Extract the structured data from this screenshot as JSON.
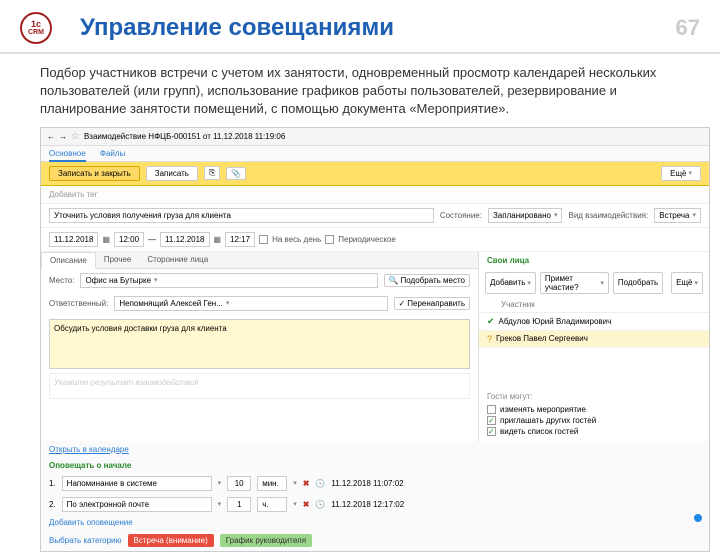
{
  "slide": {
    "logo_top": "1c",
    "logo_bottom": "CRM",
    "title": "Управление совещаниями",
    "number": "67",
    "description": "Подбор участников встречи с учетом их занятости, одновременный просмотр календарей нескольких пользователей (или групп), использование графиков работы пользователей, резервирование и планирование занятости помещений, с помощью документа «Мероприятие»."
  },
  "window": {
    "title": "Взаимодействие НФЦБ-000151 от 11.12.2018 11:19:06",
    "tabs": [
      "Основное",
      "Файлы"
    ],
    "toolbar": {
      "save_close": "Записать и закрыть",
      "save": "Записать",
      "more": "Ещё"
    },
    "add_theme_placeholder": "Добавить тег",
    "subject": "Уточнить условия получения груза для клиента",
    "status_label": "Состояние:",
    "status_value": "Запланировано",
    "type_label": "Вид взаимодействия:",
    "type_value": "Встреча",
    "date1": "11.12.2018",
    "time1": "12:00",
    "date2": "11.12.2018",
    "time2": "12:17",
    "allday_label": "На весь день",
    "periodic_label": "Периодическое",
    "inner_tabs": [
      "Описание",
      "Прочее",
      "Сторонние лица"
    ],
    "place_label": "Место:",
    "place_value": "Офис на Бутырке",
    "place_pick": "Подобрать место",
    "resp_label": "Ответственный:",
    "resp_value": "Непомнящий Алексей Ген...",
    "resp_action": "Перенаправить",
    "desc_text": "Обсудить условия доставки груза для клиента",
    "result_placeholder": "Укажите результат взаимодействия",
    "right": {
      "title": "Свои лица",
      "add_btn": "Добавить",
      "accept_btn": "Примет участие?",
      "pick_btn": "Подобрать",
      "more_btn": "Ещё",
      "col_header": "Участник",
      "participants": [
        {
          "status": "tick",
          "name": "Абдулов Юрий Владимирович"
        },
        {
          "status": "quest",
          "name": "Греков Павел Сергеевич"
        }
      ],
      "guests_title": "Гости могут:",
      "guest_opts": [
        {
          "checked": false,
          "label": "изменять мероприятие"
        },
        {
          "checked": true,
          "label": "приглашать других гостей"
        },
        {
          "checked": true,
          "label": "видеть список гостей"
        }
      ]
    },
    "open_calendar": "Открыть в календаре",
    "notify_title": "Оповещать о начале",
    "notify_rows": [
      {
        "num": "1.",
        "label": "Напоминание в системе",
        "val": "10",
        "unit": "мин.",
        "ts": "11.12.2018 11:07:02"
      },
      {
        "num": "2.",
        "label": "По электронной почте",
        "val": "1",
        "unit": "ч.",
        "ts": "11.12.2018 12:17:02"
      }
    ],
    "add_notify": "Добавить оповещение",
    "cat_label": "Выбрать категорию",
    "cat1": "Встреча (внимание)",
    "cat2": "График руководителя"
  }
}
